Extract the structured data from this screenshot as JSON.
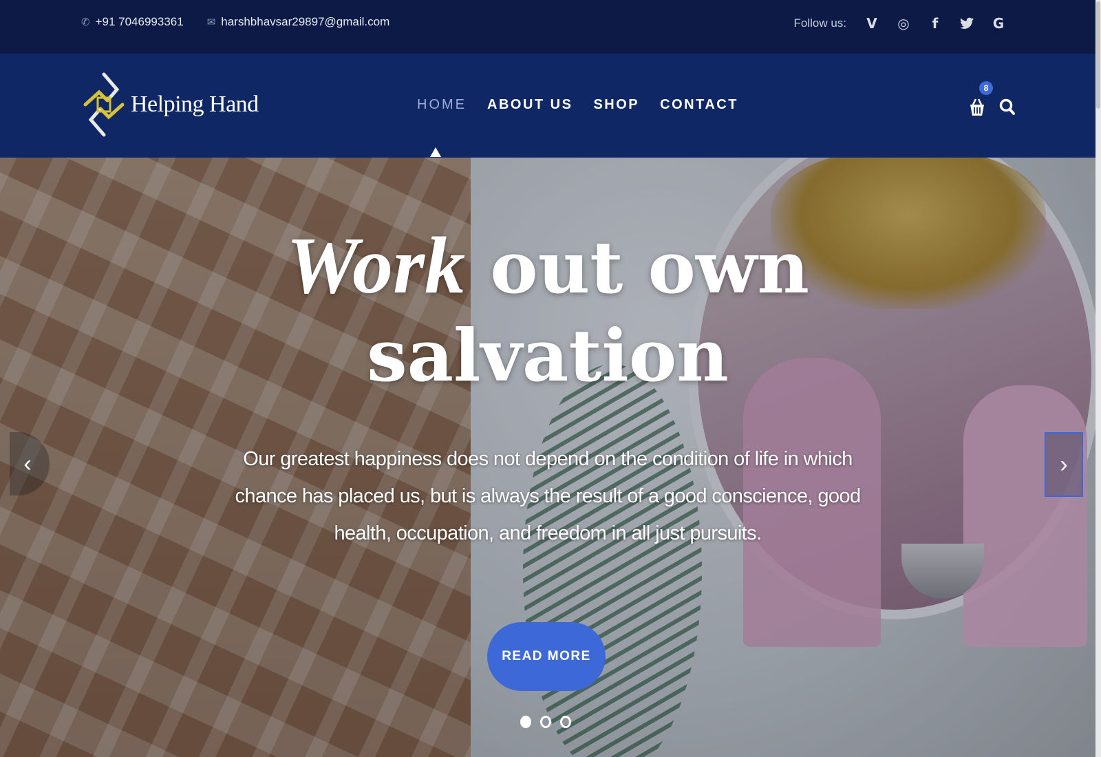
{
  "topbar": {
    "phone": "+91 7046993361",
    "email": "harshbhavsar29897@gmail.com",
    "follow_label": "Follow us:",
    "social": [
      {
        "name": "vimeo-icon",
        "glyph": "V"
      },
      {
        "name": "instagram-icon",
        "glyph": "◎"
      },
      {
        "name": "facebook-icon",
        "glyph": "f"
      },
      {
        "name": "twitter-icon",
        "glyph": "🐦"
      },
      {
        "name": "google-icon",
        "glyph": "G"
      }
    ]
  },
  "header": {
    "logo_text": "Helping Hand",
    "nav": [
      "HOME",
      "ABOUT US",
      "SHOP",
      "CONTACT"
    ],
    "active_nav": "HOME",
    "cart_count": "8"
  },
  "hero": {
    "title_em": "Work",
    "title_rest": " out own",
    "title_line2": "salvation",
    "text": "Our greatest happiness does not depend on the condition of life in which chance has placed us, but is always the result of a good conscience, good health, occupation, and freedom in all just pursuits.",
    "button": "READ MORE",
    "slides": 3,
    "active_slide": 1,
    "prev_glyph": "‹",
    "next_glyph": "›"
  },
  "colors": {
    "topbar_bg": "#0c1a45",
    "header_bg": "#102766",
    "accent": "#3d68d8"
  }
}
